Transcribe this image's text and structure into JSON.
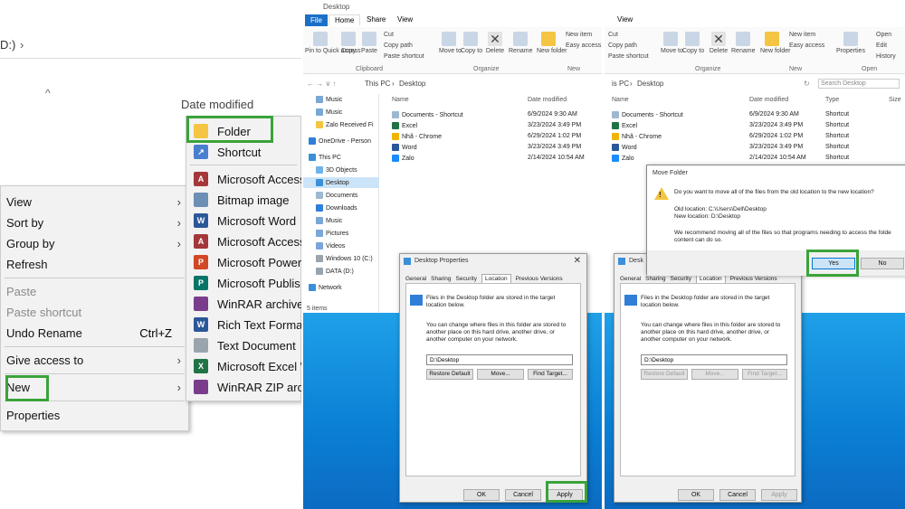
{
  "panel1": {
    "address": "D:)",
    "date_modified": "Date modified",
    "context_menu": {
      "items": [
        {
          "label": "View",
          "submenu": true
        },
        {
          "label": "Sort by",
          "submenu": true
        },
        {
          "label": "Group by",
          "submenu": true
        },
        {
          "label": "Refresh"
        },
        {
          "label": "Paste",
          "disabled": true
        },
        {
          "label": "Paste shortcut",
          "disabled": true
        },
        {
          "label": "Undo Rename",
          "shortcut": "Ctrl+Z"
        },
        {
          "label": "Give access to",
          "submenu": true
        },
        {
          "label": "New",
          "submenu": true
        },
        {
          "label": "Properties"
        }
      ]
    },
    "new_submenu": [
      {
        "label": "Folder",
        "icon": "folder-icon",
        "color": "#f4c542"
      },
      {
        "label": "Shortcut",
        "icon": "shortcut-icon",
        "color": "#4a7fd0"
      },
      {
        "label": "Microsoft Access",
        "icon": "access-icon",
        "color": "#a4373a"
      },
      {
        "label": "Bitmap image",
        "icon": "bitmap-icon",
        "color": "#6b8fb5"
      },
      {
        "label": "Microsoft Word",
        "icon": "word-icon",
        "color": "#2b579a"
      },
      {
        "label": "Microsoft Access",
        "icon": "access-icon",
        "color": "#a4373a"
      },
      {
        "label": "Microsoft Power",
        "icon": "powerpoint-icon",
        "color": "#d24726"
      },
      {
        "label": "Microsoft Publis",
        "icon": "publisher-icon",
        "color": "#077568"
      },
      {
        "label": "WinRAR archive",
        "icon": "winrar-icon",
        "color": "#7a3d8c"
      },
      {
        "label": "Rich Text Format",
        "icon": "rtf-icon",
        "color": "#2b579a"
      },
      {
        "label": "Text Document",
        "icon": "text-icon",
        "color": "#9aa4ad"
      },
      {
        "label": "Microsoft Excel W",
        "icon": "excel-icon",
        "color": "#217346"
      },
      {
        "label": "WinRAR ZIP arch",
        "icon": "winrar-icon",
        "color": "#7a3d8c"
      }
    ]
  },
  "explorer": {
    "title": "Desktop",
    "tabs": [
      "File",
      "Home",
      "Share",
      "View"
    ],
    "ribbon": {
      "pin": "Pin to Quick access",
      "copy": "Copy",
      "paste": "Paste",
      "cut": "Cut",
      "copy_path": "Copy path",
      "paste_shortcut": "Paste shortcut",
      "move_to": "Move to",
      "copy_to": "Copy to",
      "delete": "Delete",
      "rename": "Rename",
      "new_folder": "New folder",
      "new_item": "New item",
      "easy_access": "Easy access",
      "properties": "Properties",
      "open": "Open",
      "edit": "Edit",
      "history": "History",
      "groups": {
        "clipboard": "Clipboard",
        "organize": "Organize",
        "new": "New",
        "open": "Open"
      }
    },
    "path": [
      "This PC",
      "Desktop"
    ],
    "path_trunc": [
      "is PC",
      "Desktop"
    ],
    "search_placeholder": "Search Desktop",
    "headers": {
      "name": "Name",
      "date": "Date modified",
      "type": "Type",
      "size": "Size"
    },
    "sidebar": [
      "Music",
      "Music",
      "Zalo Received Fi",
      "OneDrive - Person",
      "This PC",
      "3D Objects",
      "Desktop",
      "Documents",
      "Downloads",
      "Music",
      "Pictures",
      "Videos",
      "Windows 10 (C:)",
      "DATA (D:)",
      "Network"
    ],
    "items_count": "5 items",
    "files": [
      {
        "name": "Documents - Shortcut",
        "date": "6/9/2024 9:30 AM",
        "type": "Shortcut"
      },
      {
        "name": "Excel",
        "date": "3/23/2024 3:49 PM",
        "type": "Shortcut"
      },
      {
        "name": "Nhã - Chrome",
        "date": "6/29/2024 1:02 PM",
        "type": "Shortcut"
      },
      {
        "name": "Word",
        "date": "3/23/2024 3:49 PM",
        "type": "Shortcut"
      },
      {
        "name": "Zalo",
        "date": "2/14/2024 10:54 AM",
        "type": "Shortcut"
      }
    ]
  },
  "properties_dialog": {
    "title": "Desktop Properties",
    "title_trunc": "Desk",
    "tabs": [
      "General",
      "Sharing",
      "Security",
      "Location",
      "Previous Versions"
    ],
    "info": "Files in the Desktop folder are stored in the target location below.",
    "desc": "You can change where files in this folder are stored to another place on this hard drive, another drive, or another computer on your network.",
    "path_value": "D:\\Desktop",
    "restore": "Restore Default",
    "move": "Move...",
    "find": "Find Target...",
    "ok": "OK",
    "cancel": "Cancel",
    "apply": "Apply"
  },
  "move_dialog": {
    "title": "Move Folder",
    "question": "Do you want to move all of the files from the old location to the new location?",
    "old": "Old location: C:\\Users\\Dell\\Desktop",
    "new": "New location: D:\\Desktop",
    "recommend": "We recommend moving all of the files so that programs needing to access the folde content can do so.",
    "yes": "Yes",
    "no": "No"
  },
  "colors": {
    "highlight": "#3aa33a",
    "file_tab": "#1a6fc9",
    "desktop_blue": "#0a7fd4"
  }
}
